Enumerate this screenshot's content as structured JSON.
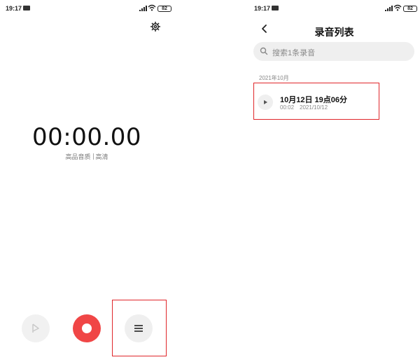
{
  "recorder": {
    "status_time": "19:17",
    "battery": "82",
    "timer": "00:00.00",
    "quality_label": "高品音质",
    "quality_value": "高清",
    "icons": [
      "settings-gear-icon",
      "play-outline-icon",
      "record-icon",
      "list-menu-icon"
    ],
    "colors": {
      "record": "#f04646",
      "highlight": "#e0262a"
    }
  },
  "recordings_list": {
    "status_time": "19:17",
    "battery": "82",
    "title": "录音列表",
    "search_placeholder": "搜索1条录音",
    "group_label": "2021年10月",
    "items": [
      {
        "name": "10月12日 19点06分",
        "duration": "00:02",
        "date": "2021/10/12"
      }
    ]
  }
}
